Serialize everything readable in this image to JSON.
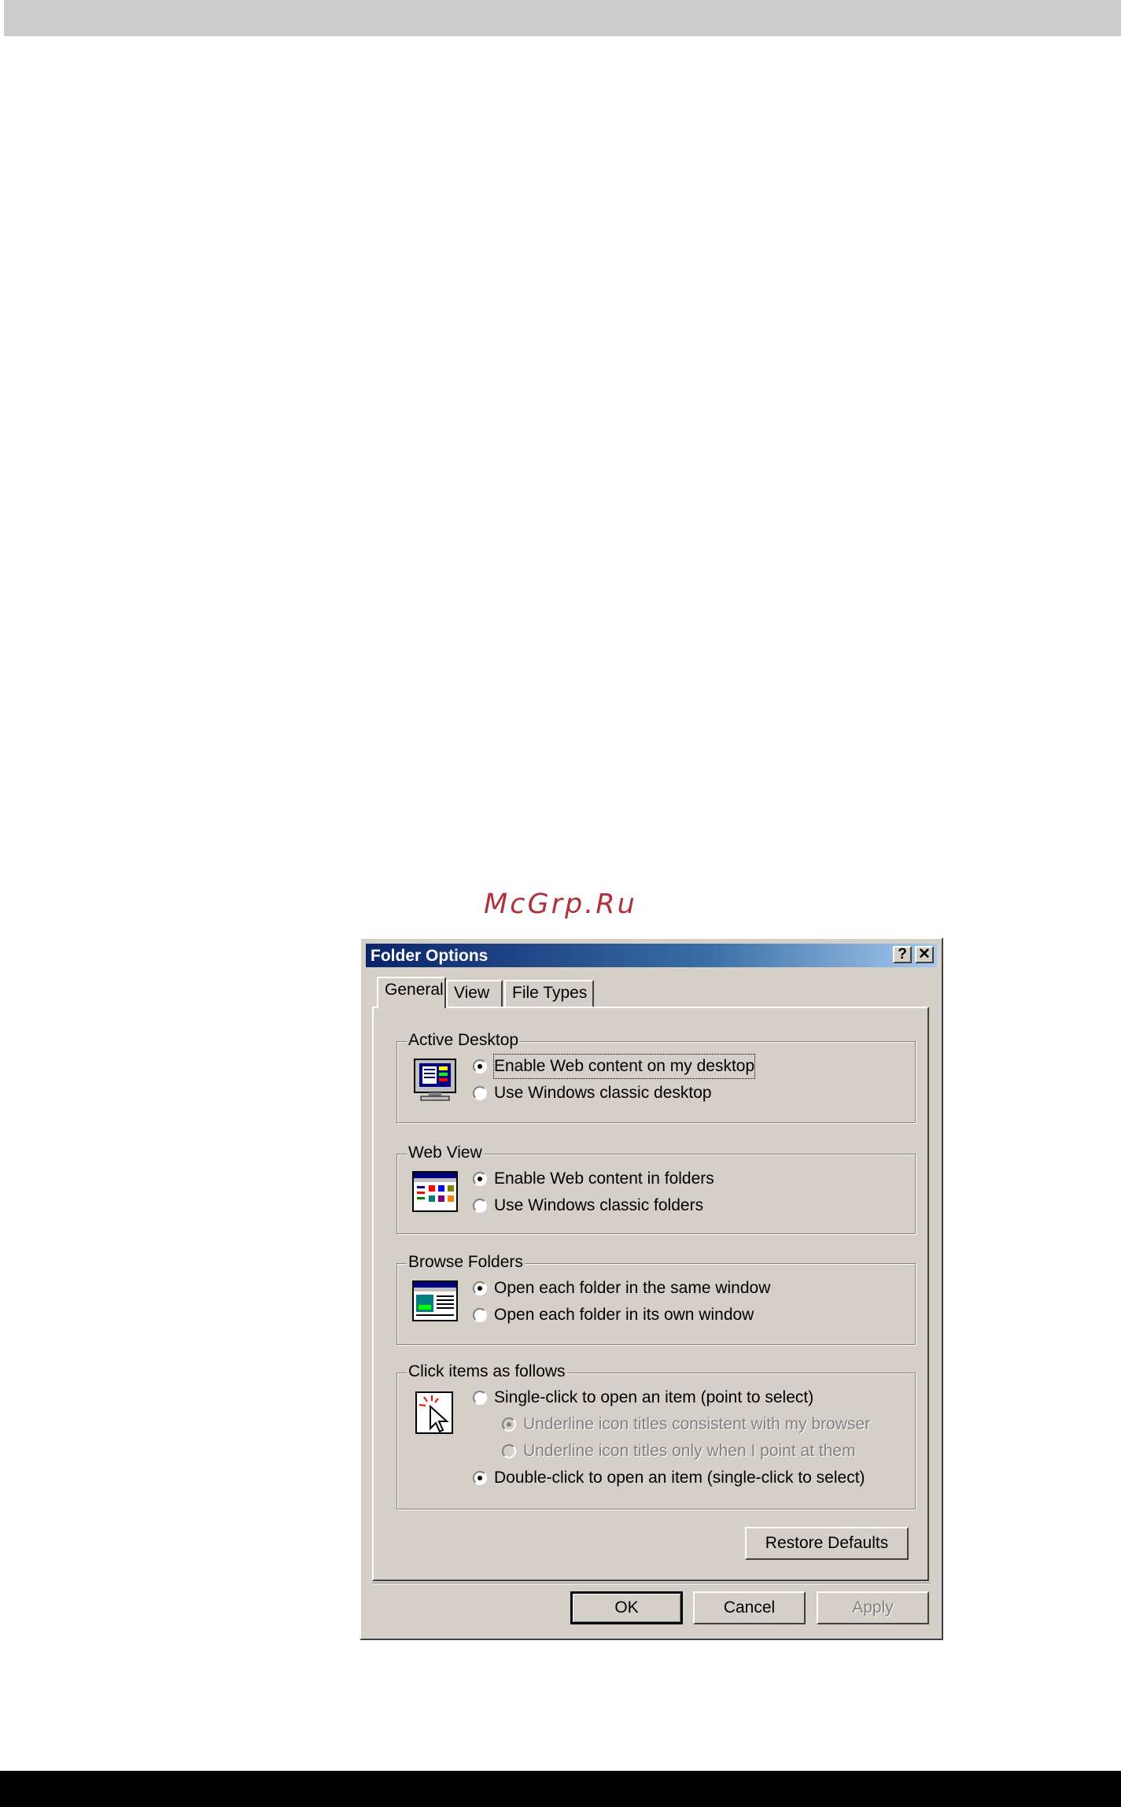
{
  "watermark": "McGrp.Ru",
  "dialog": {
    "title": "Folder Options",
    "help_button": "?",
    "close_button": "✕",
    "tabs": [
      "General",
      "View",
      "File Types"
    ],
    "active_tab": "General",
    "groups": [
      {
        "title": "Active Desktop",
        "icon": "active-desktop-icon",
        "options": [
          {
            "label": "Enable Web content on my desktop",
            "checked": true
          },
          {
            "label": "Use Windows classic desktop",
            "checked": false
          }
        ]
      },
      {
        "title": "Web View",
        "icon": "web-view-icon",
        "options": [
          {
            "label": "Enable Web content in folders",
            "checked": true
          },
          {
            "label": "Use Windows classic folders",
            "checked": false
          }
        ]
      },
      {
        "title": "Browse Folders",
        "icon": "browse-folders-icon",
        "options": [
          {
            "label": "Open each folder in the same window",
            "checked": true
          },
          {
            "label": "Open each folder in its own window",
            "checked": false
          }
        ]
      },
      {
        "title": "Click items as follows",
        "icon": "click-pointer-icon",
        "options": [
          {
            "label": "Single-click to open an item (point to select)",
            "checked": false
          },
          {
            "label": "Underline icon titles consistent with my browser",
            "checked": true,
            "disabled": true
          },
          {
            "label": "Underline icon titles only when I point at them",
            "checked": false,
            "disabled": true
          },
          {
            "label": "Double-click to open an item (single-click to select)",
            "checked": true
          }
        ]
      }
    ],
    "restore_defaults": "Restore Defaults",
    "ok": "OK",
    "cancel": "Cancel",
    "apply": "Apply"
  }
}
